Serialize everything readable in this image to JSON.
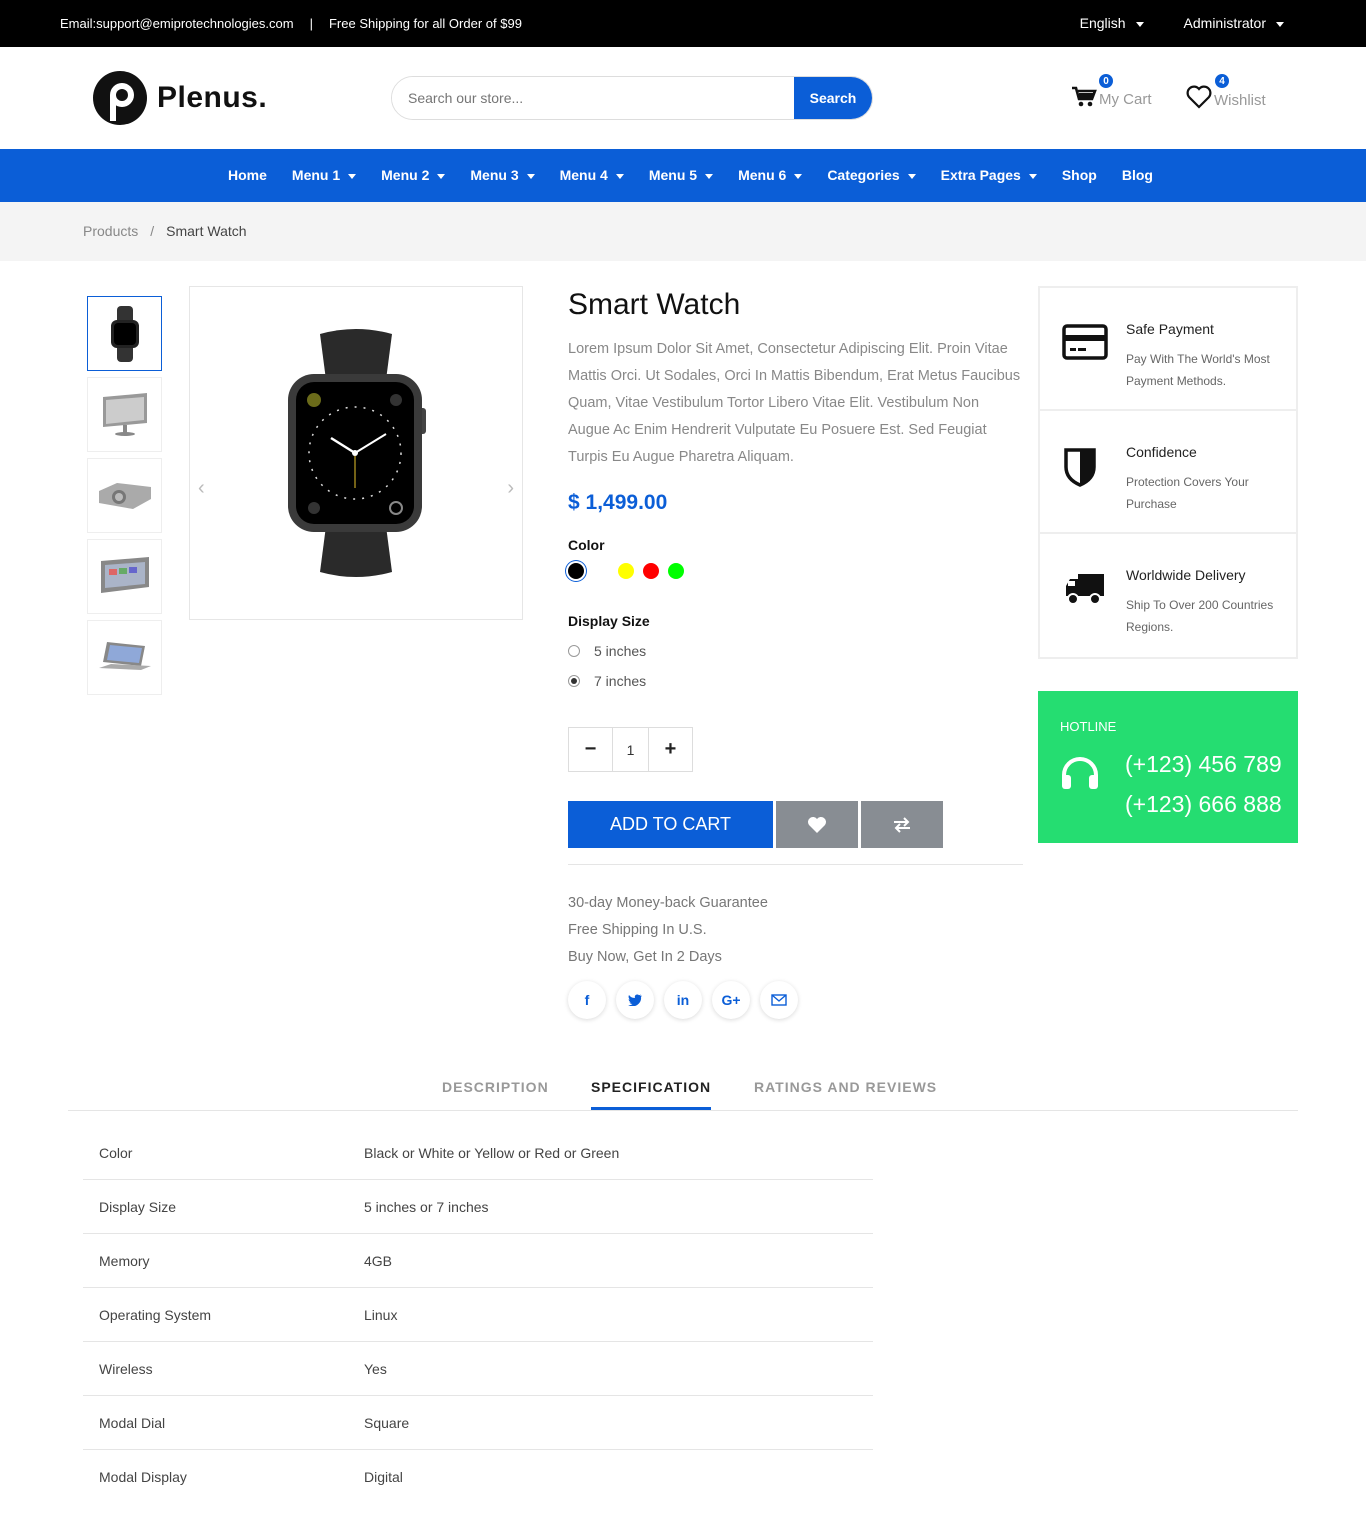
{
  "topbar": {
    "email": "Email:support@emiprotechnologies.com",
    "separator": "|",
    "shipping": "Free Shipping for all Order of $99",
    "language": "English",
    "user": "Administrator"
  },
  "header": {
    "brand": "Plenus.",
    "search": {
      "placeholder": "Search our store...",
      "button": "Search"
    },
    "cart": {
      "label": "My Cart",
      "count": "0"
    },
    "wishlist": {
      "label": "Wishlist",
      "count": "4"
    },
    "accent_color": "#0b5ed7"
  },
  "nav": {
    "items": [
      "Home",
      "Menu 1",
      "Menu 2",
      "Menu 3",
      "Menu 4",
      "Menu 5",
      "Menu 6",
      "Categories",
      "Extra Pages",
      "Shop",
      "Blog"
    ]
  },
  "breadcrumb": {
    "parent": "Products",
    "sep": "/",
    "current": "Smart Watch"
  },
  "product": {
    "title": "Smart Watch",
    "description": "Lorem Ipsum Dolor Sit Amet, Consectetur Adipiscing Elit. Proin Vitae Mattis Orci. Ut Sodales, Orci In Mattis Bibendum, Erat Metus Faucibus Quam, Vitae Vestibulum Tortor Libero Vitae Elit. Vestibulum Non Augue Ac Enim Hendrerit Vulputate Eu Posuere Est. Sed Feugiat Turpis Eu Augue Pharetra Aliquam.",
    "price": "$ 1,499.00",
    "color_label": "Color",
    "colors": [
      "#000000",
      "#ffffff",
      "#ffff00",
      "#ff0000",
      "#00ff00"
    ],
    "size_label": "Display Size",
    "sizes": [
      "5 inches",
      "7 inches"
    ],
    "selected_size": "7 inches",
    "quantity": "1",
    "add_to_cart": "ADD TO CART",
    "perks": [
      "30-day Money-back Guarantee",
      "Free Shipping In U.S.",
      "Buy Now, Get In 2 Days"
    ],
    "thumb_icons": [
      "watch-thumb-icon",
      "monitor-thumb-icon",
      "projector-thumb-icon",
      "tablet-thumb-icon",
      "laptop-thumb-icon"
    ]
  },
  "features": [
    {
      "title": "Safe Payment",
      "text": "Pay With The World's Most Payment Methods."
    },
    {
      "title": "Confidence",
      "text": "Protection Covers Your Purchase"
    },
    {
      "title": "Worldwide Delivery",
      "text": "Ship To Over 200 Countries Regions."
    }
  ],
  "hotline": {
    "label": "HOTLINE",
    "phone1": "(+123) 456 789",
    "phone2": "(+123) 666 888",
    "color": "#25dd71"
  },
  "tabs": [
    "DESCRIPTION",
    "SPECIFICATION",
    "RATINGS AND REVIEWS"
  ],
  "spec": [
    {
      "key": "Color",
      "value": "Black or White or Yellow or Red or Green"
    },
    {
      "key": "Display Size",
      "value": "5 inches or 7 inches"
    },
    {
      "key": "Memory",
      "value": "4GB"
    },
    {
      "key": "Operating System",
      "value": "Linux"
    },
    {
      "key": "Wireless",
      "value": "Yes"
    },
    {
      "key": "Modal Dial",
      "value": "Square"
    },
    {
      "key": "Modal Display",
      "value": "Digital"
    }
  ]
}
